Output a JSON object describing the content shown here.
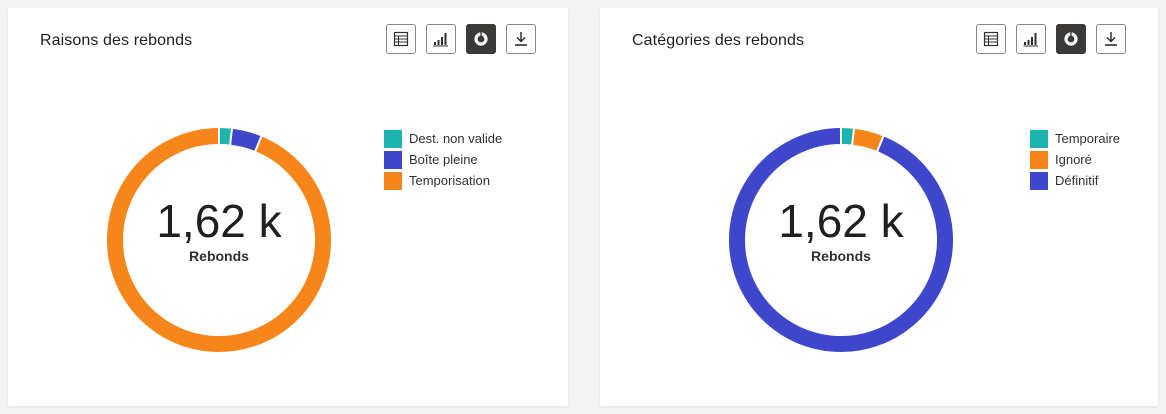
{
  "toolbar": {
    "buttons": [
      {
        "icon": "table-icon",
        "active": false
      },
      {
        "icon": "bar-chart-icon",
        "active": false
      },
      {
        "icon": "donut-chart-icon",
        "active": true
      },
      {
        "icon": "download-icon",
        "active": false
      }
    ]
  },
  "chart_data": [
    {
      "type": "pie",
      "donut": true,
      "title": "Raisons des rebonds",
      "center_value": "1,62 k",
      "center_label": "Rebonds",
      "categories": [
        "Dest. non valide",
        "Boîte pleine",
        "Temporisation"
      ],
      "values": [
        30,
        70,
        1520
      ],
      "colors": [
        "#1cb5ad",
        "#3e47cc",
        "#f7861a"
      ],
      "legend": "right"
    },
    {
      "type": "pie",
      "donut": true,
      "title": "Catégories des rebonds",
      "center_value": "1,62 k",
      "center_label": "Rebonds",
      "categories": [
        "Temporaire",
        "Ignoré",
        "Définitif"
      ],
      "values": [
        30,
        70,
        1520
      ],
      "colors": [
        "#1cb5ad",
        "#f7861a",
        "#3e47cc"
      ],
      "legend": "right"
    }
  ]
}
